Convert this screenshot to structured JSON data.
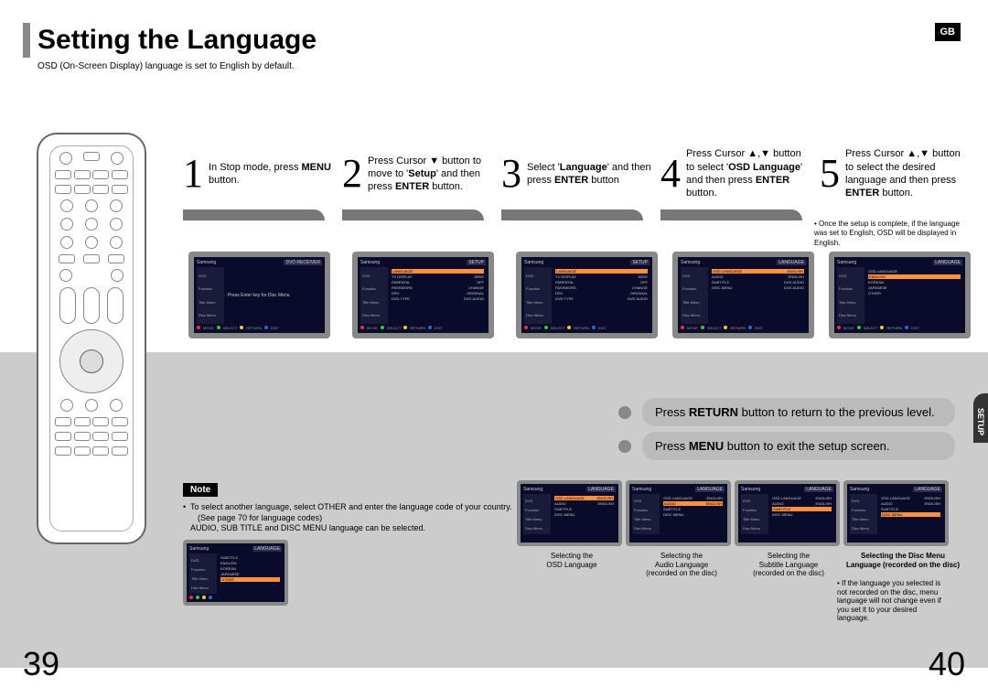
{
  "header": {
    "title": "Setting the Language",
    "subtitle": "OSD (On-Screen Display) language is set to English by default.",
    "badge": "GB"
  },
  "steps": [
    {
      "num": "1",
      "text": "In Stop mode, press <b>MENU</b> button."
    },
    {
      "num": "2",
      "text": "Press Cursor ▼ button to move to '<b>Setup</b>' and then press <b>ENTER</b> button."
    },
    {
      "num": "3",
      "text": "Select '<b>Language</b>' and then press <b>ENTER</b> button"
    },
    {
      "num": "4",
      "text": "Press Cursor ▲,▼ button to select '<b>OSD Language</b>' and then press <b>ENTER</b> button."
    },
    {
      "num": "5",
      "text": "Press Cursor ▲,▼ button to select the desired language and then press <b>ENTER</b> button."
    }
  ],
  "step5_note": "Once the setup is complete, if the language was set to English, OSD will be displayed in English.",
  "osd": {
    "title_dvdreceiver": "DVD RECEIVER",
    "title_setup": "SETUP",
    "title_language": "LANGUAGE",
    "side": [
      "DVD",
      "Function",
      "Title Menu",
      "Disc Menu"
    ],
    "press_enter": "Press Enter key for Disc Menu",
    "setup_rows": [
      [
        "LANGUAGE",
        ""
      ],
      [
        "TV DISPLAY",
        "WIDE",
        ""
      ],
      [
        "PARENTAL",
        "OFF",
        ""
      ],
      [
        "PASSWORD",
        "CHANGE",
        ""
      ],
      [
        "DRC",
        "ORIGINAL",
        ""
      ],
      [
        "DVD TYPE",
        "DVD AUDIO",
        ""
      ]
    ],
    "lang_rows": [
      [
        "OSD LANGUAGE",
        "ENGLISH"
      ],
      [
        "AUDIO",
        "ENGLISH"
      ],
      [
        "SUBTITLE",
        "DVD AUDIO"
      ],
      [
        "DISC MENU",
        "DVD AUDIO"
      ]
    ],
    "lang_opts": [
      "ENGLISH",
      "KOREAN",
      "JAPANESE",
      "OTHER"
    ],
    "ftr": [
      "MOVE",
      "SELECT",
      "RETURN",
      "EXIT"
    ]
  },
  "callouts": {
    "return": "Press <b>RETURN</b> button to return to the previous level.",
    "menu": "Press <b>MENU</b> button to exit the setup screen."
  },
  "side_tab": "SETUP",
  "note": {
    "label": "Note",
    "line1": "To select another language, select OTHER and enter the language code of your country.",
    "line1sub": "(See page 70 for language codes)",
    "line2": "AUDIO, SUB TITLE and DISC MENU language can be selected."
  },
  "captions": [
    "Selecting the\nOSD Language",
    "Selecting the\nAudio Language\n(recorded on the disc)",
    "Selecting the\nSubtitle Language\n(recorded on the disc)",
    "Selecting the Disc Menu\nLanguage (recorded on the disc)"
  ],
  "caption_note": "If the language you selected is not recorded on the disc, menu language will not change even if you set it to your desired language.",
  "page_left": "39",
  "page_right": "40"
}
